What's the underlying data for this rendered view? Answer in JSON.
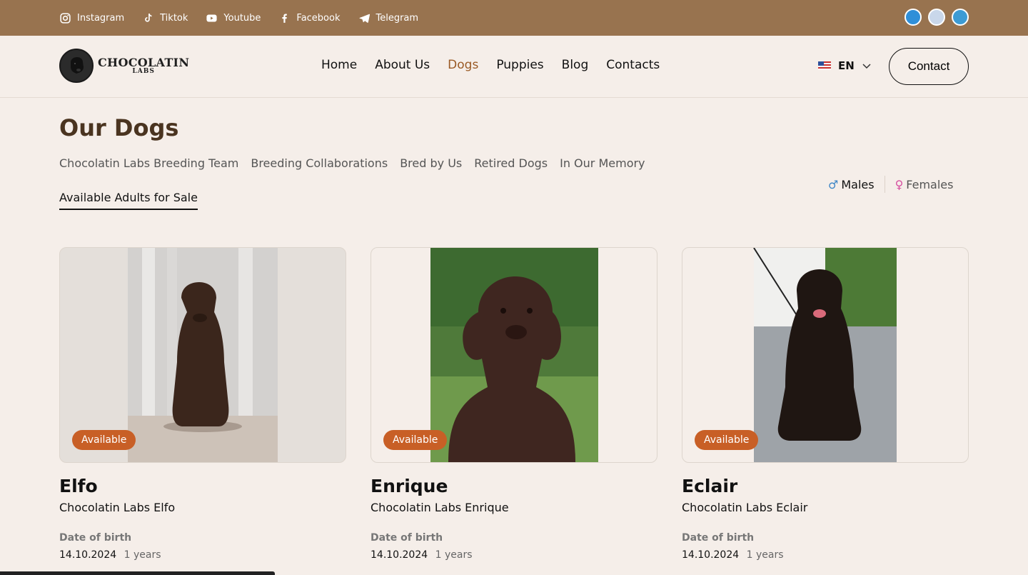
{
  "topbar": {
    "social": [
      {
        "label": "Instagram",
        "icon": "instagram-icon"
      },
      {
        "label": "Tiktok",
        "icon": "tiktok-icon"
      },
      {
        "label": "Youtube",
        "icon": "youtube-icon"
      },
      {
        "label": "Facebook",
        "icon": "facebook-icon"
      },
      {
        "label": "Telegram",
        "icon": "telegram-icon"
      }
    ]
  },
  "nav": {
    "logo_main": "CHOCOLATIN",
    "logo_sub": "LABS",
    "menu": [
      "Home",
      "About Us",
      "Dogs",
      "Puppies",
      "Blog",
      "Contacts"
    ],
    "active_menu": "Dogs",
    "lang": "EN",
    "contact_label": "Contact"
  },
  "main": {
    "title": "Our Dogs",
    "subnav": [
      "Chocolatin Labs Breeding Team",
      "Breeding Collaborations",
      "Bred by Us",
      "Retired Dogs",
      "In Our Memory"
    ],
    "subnav_active": "Available Adults for Sale",
    "filter_male": "Males",
    "filter_female": "Females",
    "cards": [
      {
        "badge": "Available",
        "name": "Elfo",
        "full_name": "Chocolatin Labs Elfo",
        "dob_label": "Date of birth",
        "dob": "14.10.2024",
        "age": "1 years"
      },
      {
        "badge": "Available",
        "name": "Enrique",
        "full_name": "Chocolatin Labs Enrique",
        "dob_label": "Date of birth",
        "dob": "14.10.2024",
        "age": "1 years"
      },
      {
        "badge": "Available",
        "name": "Eclair",
        "full_name": "Chocolatin Labs Eclair",
        "dob_label": "Date of birth",
        "dob": "14.10.2024",
        "age": "1 years"
      }
    ]
  },
  "colors": {
    "topbar": "#98734f",
    "accent": "#9a5a25",
    "badge": "#c85f26",
    "title": "#4a3420",
    "background": "#f5eee9"
  }
}
